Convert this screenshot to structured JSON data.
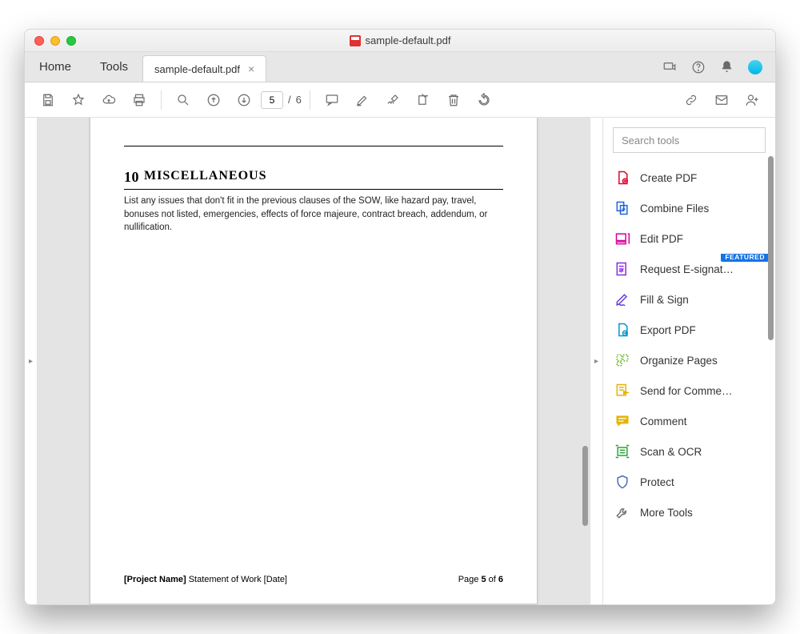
{
  "window": {
    "title": "sample-default.pdf"
  },
  "tabs": {
    "home": "Home",
    "tools": "Tools",
    "active": "sample-default.pdf"
  },
  "page_nav": {
    "current": "5",
    "sep": "/",
    "total": "6"
  },
  "doc": {
    "section_number": "10",
    "section_title": "MISCELLANEOUS",
    "body": "List any issues that don't fit in the previous clauses of the SOW, like hazard pay, travel, bonuses not listed, emergencies, effects of force majeure, contract breach, addendum, or nullification.",
    "footer_left_bold": "[Project Name]",
    "footer_left_rest": " Statement of Work [Date]",
    "footer_right_pre": "Page ",
    "footer_right_cur": "5",
    "footer_right_mid": " of ",
    "footer_right_tot": "6"
  },
  "rpanel": {
    "search_placeholder": "Search tools",
    "featured_badge": "FEATURED",
    "items": [
      {
        "label": "Create PDF",
        "color": "#e1002d"
      },
      {
        "label": "Combine Files",
        "color": "#2262dd"
      },
      {
        "label": "Edit PDF",
        "color": "#d6009a"
      },
      {
        "label": "Request E-signat…",
        "color": "#8a2be2",
        "featured": true
      },
      {
        "label": "Fill & Sign",
        "color": "#6b3fd9"
      },
      {
        "label": "Export PDF",
        "color": "#0099cc"
      },
      {
        "label": "Organize Pages",
        "color": "#5fb41c"
      },
      {
        "label": "Send for Comme…",
        "color": "#e6b400"
      },
      {
        "label": "Comment",
        "color": "#e6b400"
      },
      {
        "label": "Scan & OCR",
        "color": "#2aa33a"
      },
      {
        "label": "Protect",
        "color": "#4a6fb8"
      },
      {
        "label": "More Tools",
        "color": "#767676"
      }
    ]
  }
}
